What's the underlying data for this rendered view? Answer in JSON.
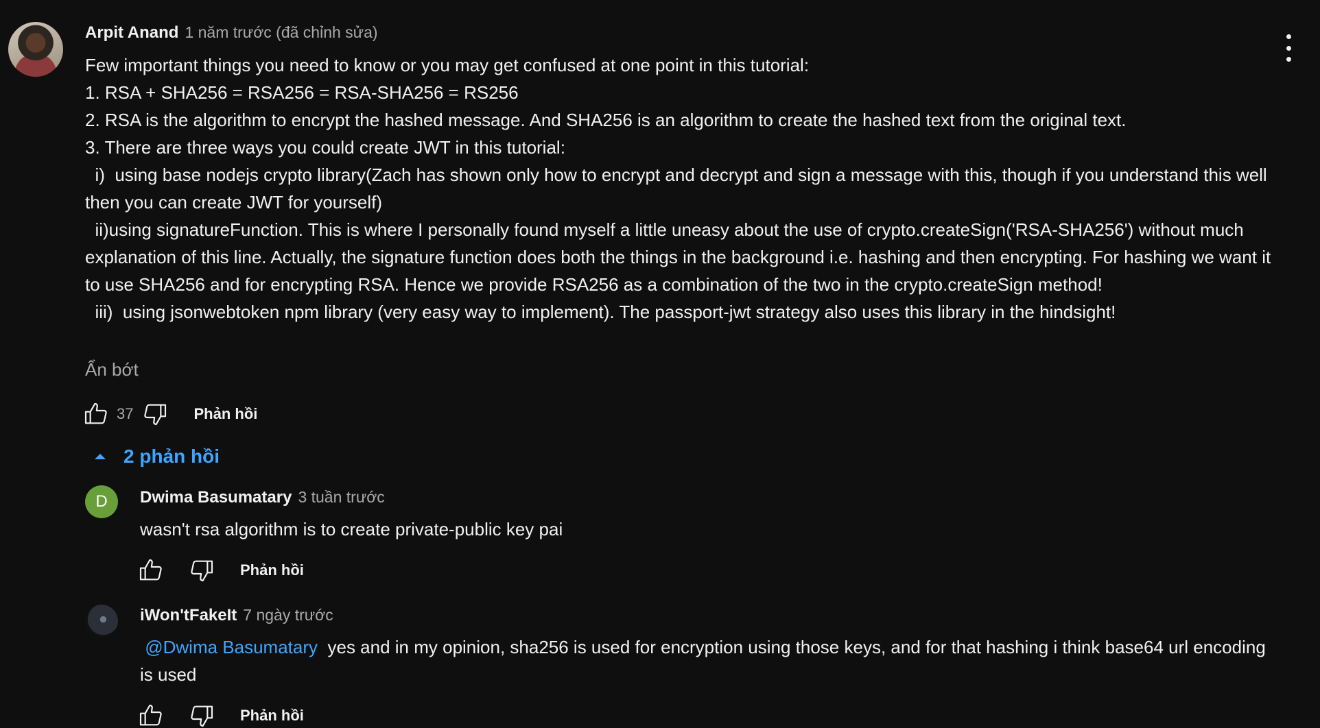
{
  "main_comment": {
    "author": "Arpit Anand",
    "timestamp": "1 năm trước (đã chỉnh sửa)",
    "lines": [
      "Few important things you need to know or you may get confused at one point in this tutorial:",
      "1. RSA + SHA256 = RSA256 = RSA-SHA256 = RS256",
      "2. RSA is the algorithm to encrypt the hashed message. And SHA256 is an algorithm to create the hashed text from the original text.",
      "3. There are three ways you could create JWT in this tutorial:",
      "  i)  using base nodejs crypto library(Zach has shown only how to encrypt and decrypt and sign a message with this, though if you understand this well then you can create JWT for yourself)",
      "  ii)using signatureFunction. This is where I personally found myself a little uneasy about the use of crypto.createSign('RSA-SHA256') without much explanation of this line. Actually, the signature function does both the things in the background i.e. hashing and then encrypting. For hashing we want it to use SHA256 and for encrypting RSA. Hence we provide RSA256 as a combination of the two in the crypto.createSign method!",
      "  iii)  using jsonwebtoken npm library (very easy way to implement). The passport-jwt strategy also uses this library in the hindsight!"
    ],
    "show_less": "Ẩn bớt",
    "like_count": "37",
    "reply_label": "Phản hồi",
    "like_icon": "thumbs-up-icon",
    "dislike_icon": "thumbs-down-icon",
    "menu_icon": "more-vertical-icon"
  },
  "replies_toggle": {
    "label": "2 phản hồi",
    "icon": "chevron-up-icon",
    "color": "#3ea6ff"
  },
  "replies": [
    {
      "author": "Dwima Basumatary",
      "timestamp": "3 tuần trước",
      "avatar_letter": "D",
      "avatar_color": "#689f38",
      "text": "wasn't rsa algorithm is to create private-public key pai",
      "reply_label": "Phản hồi"
    },
    {
      "author": "iWon'tFakeIt",
      "timestamp": "7 ngày trước",
      "mention": "@Dwima Basumatary",
      "text": "yes and in my opinion, sha256 is used for encryption using those keys, and for that hashing i think base64 url encoding is used",
      "reply_label": "Phản hồi"
    }
  ]
}
